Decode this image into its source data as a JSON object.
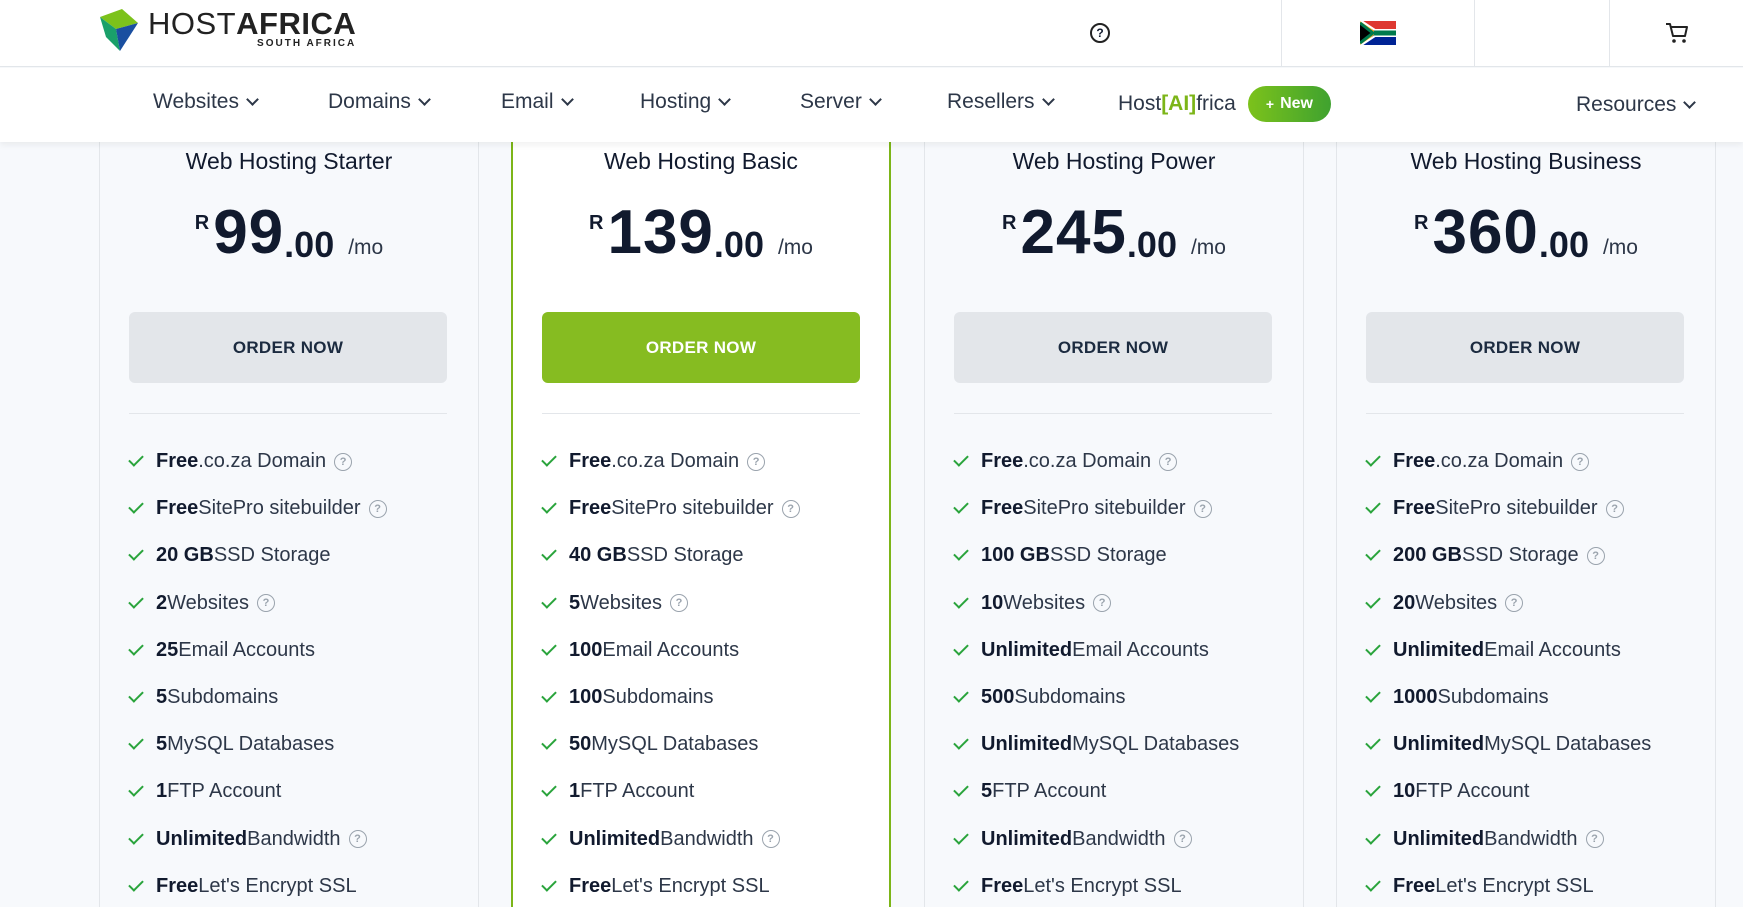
{
  "brand": {
    "name_light": "HOST",
    "name_bold": "AFRICA",
    "tagline": "SOUTH AFRICA"
  },
  "topbar": {
    "help_icon": "question-circle-icon",
    "flag_icon": "south-africa-flag-icon",
    "cart_icon": "cart-icon"
  },
  "nav": {
    "items": [
      "Websites",
      "Domains",
      "Email",
      "Hosting",
      "Server",
      "Resellers"
    ],
    "ai_prefix": "Host",
    "ai_bracket": "[AI]",
    "ai_suffix": "frica",
    "new_badge": "New",
    "resources": "Resources"
  },
  "colors": {
    "accent_green": "#86bc21",
    "check_green": "#2aa43c",
    "button_gray": "#e3e6ea"
  },
  "plans": [
    {
      "title": "Web Hosting Starter",
      "currency": "R",
      "whole": "99",
      "cents": ".00",
      "per": "/mo",
      "order_label": "ORDER NOW",
      "features": [
        {
          "bold": "Free",
          "text": ".co.za Domain",
          "help": true
        },
        {
          "bold": "Free",
          "text": " SitePro sitebuilder",
          "help": true
        },
        {
          "bold": "20 GB",
          "text": " SSD Storage",
          "help": false
        },
        {
          "bold": "2",
          "text": " Websites",
          "help": true
        },
        {
          "bold": "25",
          "text": " Email Accounts",
          "help": false
        },
        {
          "bold": "5",
          "text": " Subdomains",
          "help": false
        },
        {
          "bold": "5",
          "text": " MySQL Databases",
          "help": false
        },
        {
          "bold": "1",
          "text": " FTP Account",
          "help": false
        },
        {
          "bold": "Unlimited",
          "text": " Bandwidth",
          "help": true
        },
        {
          "bold": "Free",
          "text": " Let's Encrypt SSL",
          "help": false
        }
      ]
    },
    {
      "title": "Web Hosting Basic",
      "currency": "R",
      "whole": "139",
      "cents": ".00",
      "per": "/mo",
      "order_label": "ORDER NOW",
      "features": [
        {
          "bold": "Free",
          "text": " .co.za Domain",
          "help": true
        },
        {
          "bold": "Free",
          "text": " SitePro sitebuilder",
          "help": true
        },
        {
          "bold": "40 GB",
          "text": " SSD Storage",
          "help": false
        },
        {
          "bold": "5",
          "text": " Websites",
          "help": true
        },
        {
          "bold": "100",
          "text": " Email Accounts",
          "help": false
        },
        {
          "bold": "100",
          "text": " Subdomains",
          "help": false
        },
        {
          "bold": "50",
          "text": " MySQL Databases",
          "help": false
        },
        {
          "bold": "1",
          "text": " FTP Account",
          "help": false
        },
        {
          "bold": "Unlimited",
          "text": " Bandwidth",
          "help": true
        },
        {
          "bold": "Free",
          "text": " Let's Encrypt SSL",
          "help": false
        }
      ]
    },
    {
      "title": "Web Hosting Power",
      "currency": "R",
      "whole": "245",
      "cents": ".00",
      "per": "/mo",
      "order_label": "ORDER NOW",
      "features": [
        {
          "bold": "Free",
          "text": " .co.za Domain",
          "help": true
        },
        {
          "bold": "Free",
          "text": " SitePro sitebuilder",
          "help": true
        },
        {
          "bold": "100 GB",
          "text": " SSD Storage",
          "help": false
        },
        {
          "bold": "10",
          "text": " Websites",
          "help": true
        },
        {
          "bold": "Unlimited",
          "text": " Email Accounts",
          "help": false
        },
        {
          "bold": "500",
          "text": " Subdomains",
          "help": false
        },
        {
          "bold": "Unlimited",
          "text": " MySQL Databases",
          "help": false
        },
        {
          "bold": "5",
          "text": " FTP Account",
          "help": false
        },
        {
          "bold": "Unlimited",
          "text": " Bandwidth",
          "help": true
        },
        {
          "bold": "Free",
          "text": " Let's Encrypt SSL",
          "help": false
        }
      ]
    },
    {
      "title": "Web Hosting Business",
      "currency": "R",
      "whole": "360",
      "cents": ".00",
      "per": "/mo",
      "order_label": "ORDER NOW",
      "features": [
        {
          "bold": "Free",
          "text": " .co.za Domain",
          "help": true
        },
        {
          "bold": "Free",
          "text": " SitePro sitebuilder",
          "help": true
        },
        {
          "bold": "200 GB",
          "text": " SSD Storage",
          "help": true
        },
        {
          "bold": "20",
          "text": " Websites",
          "help": true
        },
        {
          "bold": "Unlimited",
          "text": " Email Accounts",
          "help": false
        },
        {
          "bold": "1000",
          "text": " Subdomains",
          "help": false
        },
        {
          "bold": "Unlimited",
          "text": " MySQL Databases",
          "help": false
        },
        {
          "bold": "10",
          "text": " FTP Account",
          "help": false
        },
        {
          "bold": "Unlimited",
          "text": " Bandwidth",
          "help": true
        },
        {
          "bold": "Free",
          "text": " Let's Encrypt SSL",
          "help": false
        }
      ]
    }
  ]
}
